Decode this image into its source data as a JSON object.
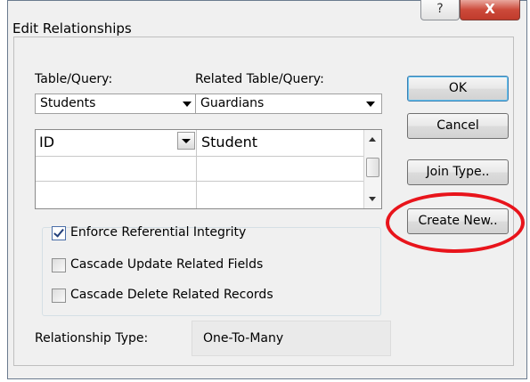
{
  "dialog": {
    "title": "Edit Relationships",
    "help_glyph": "?",
    "close_glyph": "X"
  },
  "labels": {
    "table_query": "Table/Query:",
    "related_table_query": "Related Table/Query:"
  },
  "combos": {
    "table": "Students",
    "related_table": "Guardians"
  },
  "fields_grid": {
    "rows": [
      [
        "ID",
        "Student"
      ],
      [
        "",
        ""
      ],
      [
        "",
        ""
      ]
    ]
  },
  "options": {
    "enforce": {
      "label": "Enforce Referential Integrity",
      "checked": true
    },
    "cascade_update": {
      "label": "Cascade Update Related Fields",
      "checked": false
    },
    "cascade_delete": {
      "label": "Cascade Delete Related Records",
      "checked": false
    }
  },
  "relationship": {
    "label": "Relationship Type:",
    "value": "One-To-Many"
  },
  "buttons": {
    "ok": "OK",
    "cancel": "Cancel",
    "join_type": "Join Type..",
    "create_new": "Create New.."
  },
  "colors": {
    "highlight_circle": "#e8141b",
    "close_button": "#c03b2c"
  }
}
